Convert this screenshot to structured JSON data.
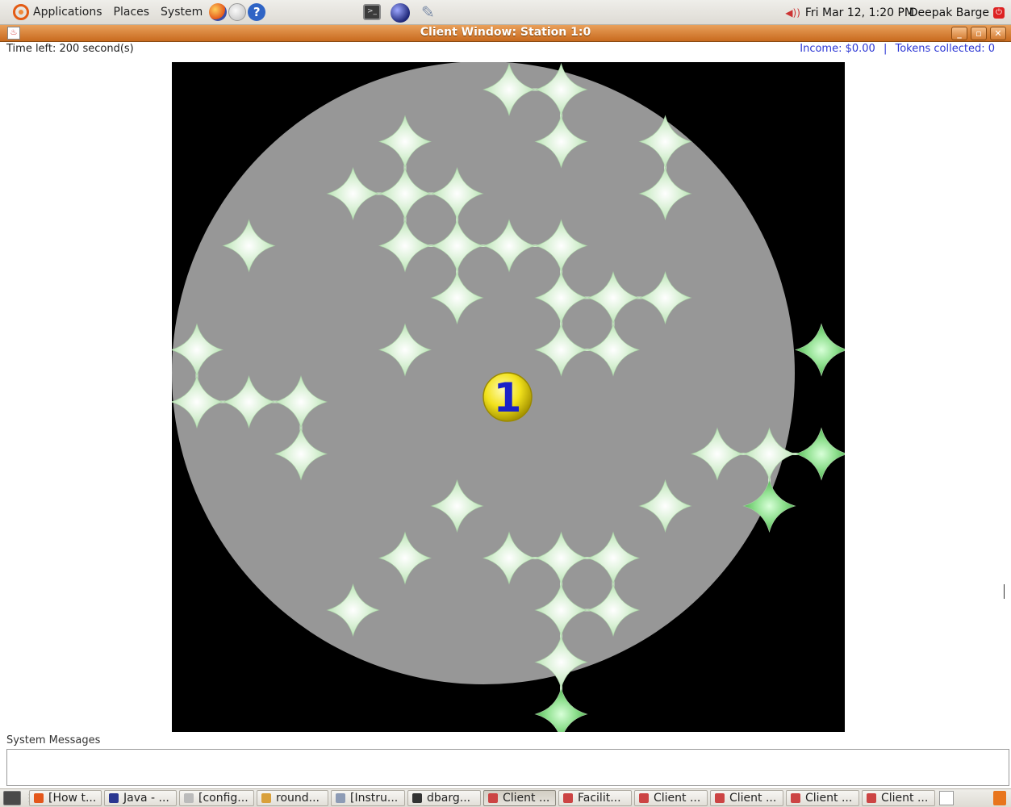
{
  "top_panel": {
    "menus": [
      "Applications",
      "Places",
      "System"
    ],
    "datetime": "Fri Mar 12,  1:20 PM",
    "user": "Deepak Barge"
  },
  "window": {
    "title": "Client Window: Station 1:0"
  },
  "status": {
    "time_left": "Time left: 200 second(s)",
    "income": "Income: $0.00",
    "separator": "|",
    "tokens": "Tokens collected: 0"
  },
  "game": {
    "player_label": "1",
    "colors": {
      "background": "#000000",
      "vision": "#979797",
      "token": "#d8f0d4",
      "token_outside": "#8fe08f",
      "player": "#f2e21c",
      "player_label": "#1a22c8"
    }
  },
  "messages": {
    "label": "System Messages",
    "text": ""
  },
  "taskbar": {
    "items": [
      {
        "label": "[How t...",
        "icon": "firefox-icon",
        "active": false
      },
      {
        "label": "Java - ...",
        "icon": "eclipse-icon",
        "active": false
      },
      {
        "label": "[config...",
        "icon": "file-icon",
        "active": false
      },
      {
        "label": "round...",
        "icon": "editor-icon",
        "active": false
      },
      {
        "label": "[Instru...",
        "icon": "pen-icon",
        "active": false
      },
      {
        "label": "dbarg...",
        "icon": "terminal-icon",
        "active": false
      },
      {
        "label": "Client ...",
        "icon": "java-icon",
        "active": true
      },
      {
        "label": "Facilit...",
        "icon": "java-icon",
        "active": false
      },
      {
        "label": "Client ...",
        "icon": "java-icon",
        "active": false
      },
      {
        "label": "Client ...",
        "icon": "java-icon",
        "active": false
      },
      {
        "label": "Client ...",
        "icon": "java-icon",
        "active": false
      },
      {
        "label": "Client ...",
        "icon": "java-icon",
        "active": false
      }
    ]
  }
}
